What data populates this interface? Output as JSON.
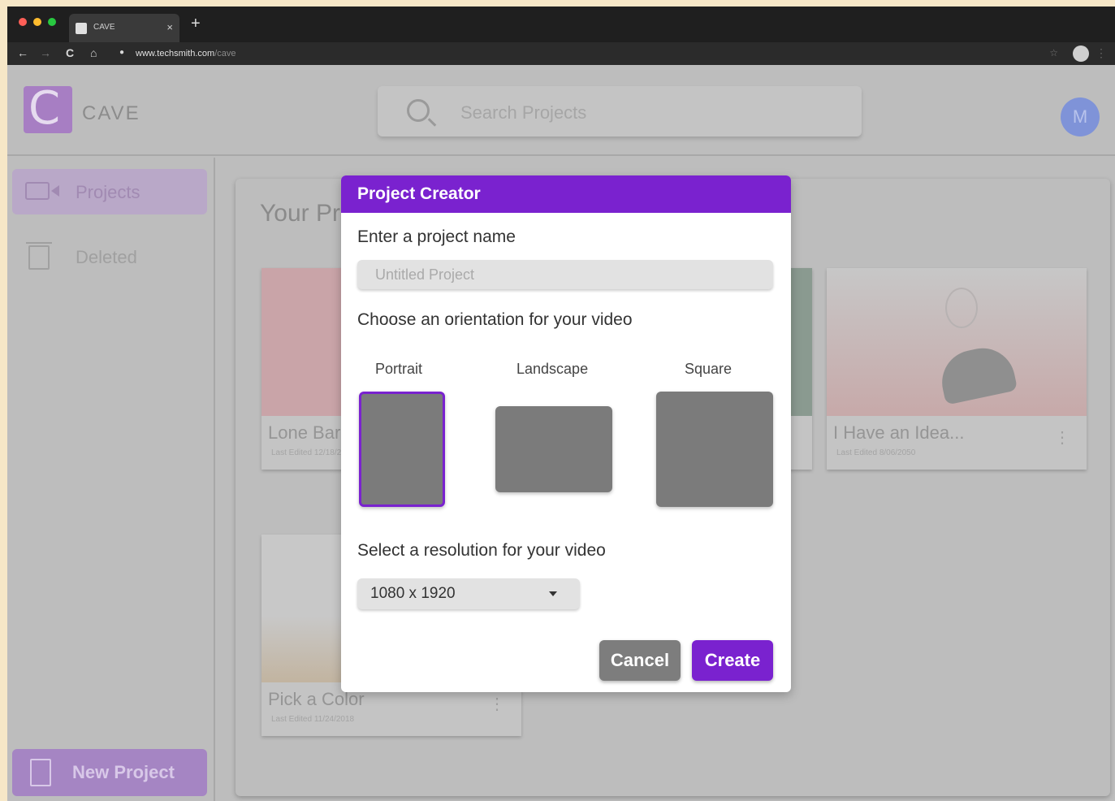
{
  "browser": {
    "tab_title": "CAVE",
    "tab_close": "×",
    "new_tab": "+",
    "url_host": "www.techsmith.com",
    "url_path": "/cave",
    "nav_back": "←",
    "nav_forward": "→",
    "nav_reload": "C",
    "nav_home": "⌂"
  },
  "app": {
    "logo_letter": "C",
    "logo_text": "CAVE",
    "search_placeholder": "Search Projects",
    "avatar_initial": "M"
  },
  "sidebar": {
    "items": [
      {
        "label": "Projects",
        "icon": "camera-icon",
        "active": true
      },
      {
        "label": "Deleted",
        "icon": "trash-icon",
        "active": false
      }
    ],
    "new_project_label": "New Project"
  },
  "main": {
    "title": "Your Projects",
    "cards": [
      {
        "title": "Lone Barn",
        "date": "Last Edited 12/18/2018"
      },
      {
        "title": "I Have an Idea...",
        "date": "Last Edited 8/06/2050"
      },
      {
        "title": "Pick a Color",
        "date": "Last Edited 11/24/2018"
      }
    ]
  },
  "modal": {
    "title": "Project Creator",
    "name_label": "Enter a project name",
    "name_placeholder": "Untitled Project",
    "name_value": "",
    "orientation_label": "Choose an orientation for your video",
    "orientations": [
      {
        "label": "Portrait",
        "selected": true
      },
      {
        "label": "Landscape",
        "selected": false
      },
      {
        "label": "Square",
        "selected": false
      }
    ],
    "resolution_label": "Select a resolution for your video",
    "resolution_value": "1080 x 1920",
    "cancel_label": "Cancel",
    "create_label": "Create"
  },
  "colors": {
    "accent": "#7a22cf",
    "overlay_gray": "#bdbdbd",
    "tile_gray": "#7b7b7b"
  }
}
